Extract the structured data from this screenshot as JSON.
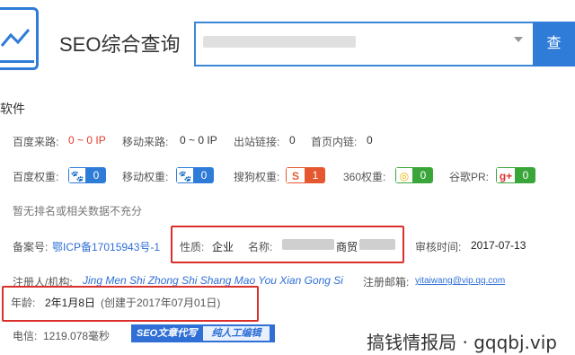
{
  "header": {
    "brand": "SEO综合查询",
    "search_button": "查"
  },
  "section_title": "软件",
  "row1": {
    "baidu_source_label": "百度来路:",
    "baidu_source_value": "0 ~ 0 IP",
    "mobile_source_label": "移动来路:",
    "mobile_source_value": "0 ~ 0 IP",
    "outlinks_label": "出站链接:",
    "outlinks_value": "0",
    "homepage_inlinks_label": "首页内链:",
    "homepage_inlinks_value": "0"
  },
  "row2": {
    "baidu_weight_label": "百度权重:",
    "baidu_weight_value": "0",
    "mobile_weight_label": "移动权重:",
    "mobile_weight_value": "0",
    "sogou_weight_label": "搜狗权重:",
    "sogou_weight_icon": "S",
    "sogou_weight_value": "1",
    "w360_label": "360权重:",
    "w360_value": "0",
    "google_pr_label": "谷歌PR:",
    "google_pr_icon": "g+",
    "google_pr_value": "0"
  },
  "no_rank_note": "暂无排名或相关数据不充分",
  "record": {
    "icp_label": "备案号:",
    "icp_value": "鄂ICP备17015943号-1",
    "nature_label": "性质:",
    "nature_value": "企业",
    "name_label": "名称:",
    "name_suffix": "商贸",
    "audit_label": "审核时间:",
    "audit_value": "2017-07-13"
  },
  "registrant": {
    "label": "注册人/机构:",
    "value": "Jing Men Shi Zhong Shi Shang Mao You Xian Gong Si",
    "email_label": "注册邮箱:",
    "email_value": "yitaiwang@vip.qq.com"
  },
  "age": {
    "label": "年龄:",
    "value": "2年1月8日",
    "created": "(创建于2017年07月01日)"
  },
  "telecom": {
    "label": "电信:",
    "value": "1219.078毫秒"
  },
  "badge": {
    "left": "SEO文章代写",
    "right": "纯人工编辑"
  },
  "watermark": "搞钱情报局 · gqqbj.vip",
  "colors": {
    "accent": "#2f7cd8",
    "highlight": "#d9302c",
    "red_value": "#e23a2e"
  }
}
